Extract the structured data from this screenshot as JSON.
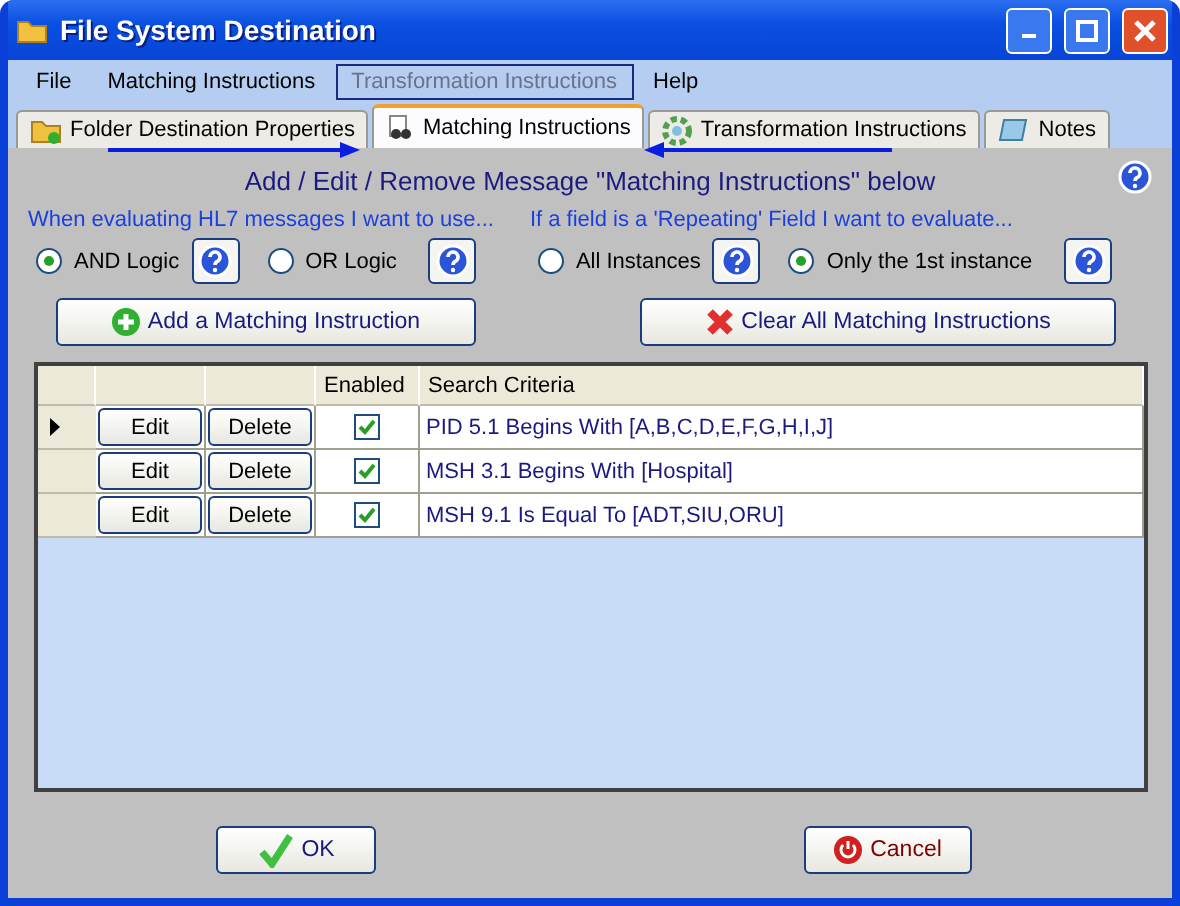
{
  "window": {
    "title": "File System Destination"
  },
  "menu": [
    {
      "label": "File",
      "disabled": false,
      "highlighted": false
    },
    {
      "label": "Matching Instructions",
      "disabled": false,
      "highlighted": false
    },
    {
      "label": "Transformation Instructions",
      "disabled": true,
      "highlighted": true
    },
    {
      "label": "Help",
      "disabled": false,
      "highlighted": false
    }
  ],
  "tabs": [
    {
      "label": "Folder Destination Properties",
      "selected": false,
      "kind": "folder"
    },
    {
      "label": "Matching Instructions",
      "selected": true,
      "kind": "binoculars"
    },
    {
      "label": "Transformation Instructions",
      "selected": false,
      "kind": "gear"
    },
    {
      "label": "Notes",
      "selected": false,
      "kind": "notes"
    }
  ],
  "heading": "Add / Edit / Remove Message \"Matching Instructions\" below",
  "logic": {
    "caption": "When evaluating HL7 messages I want to use...",
    "options": [
      {
        "label": "AND Logic",
        "selected": true
      },
      {
        "label": "OR Logic",
        "selected": false
      }
    ]
  },
  "repeating": {
    "caption": "If a field is a 'Repeating' Field I want to evaluate...",
    "options": [
      {
        "label": "All Instances",
        "selected": false
      },
      {
        "label": "Only the 1st instance",
        "selected": true
      }
    ]
  },
  "add_button": "Add a Matching Instruction",
  "clear_button": "Clear All Matching Instructions",
  "table": {
    "columns": [
      "Enabled",
      "Search Criteria"
    ],
    "rows": [
      {
        "current": true,
        "edit": "Edit",
        "delete": "Delete",
        "enabled": true,
        "criteria": "PID 5.1 Begins With [A,B,C,D,E,F,G,H,I,J]"
      },
      {
        "current": false,
        "edit": "Edit",
        "delete": "Delete",
        "enabled": true,
        "criteria": "MSH 3.1 Begins With [Hospital]"
      },
      {
        "current": false,
        "edit": "Edit",
        "delete": "Delete",
        "enabled": true,
        "criteria": "MSH 9.1 Is Equal To [ADT,SIU,ORU]"
      }
    ]
  },
  "ok_button": "OK",
  "cancel_button": "Cancel"
}
